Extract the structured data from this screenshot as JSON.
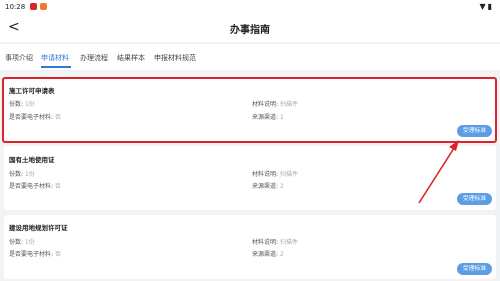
{
  "status_bar": {
    "time": "10:28"
  },
  "header": {
    "back_glyph": "<",
    "title": "办事指南"
  },
  "tabs": [
    {
      "label": "事项介绍",
      "active": false
    },
    {
      "label": "申请材料",
      "active": true
    },
    {
      "label": "办理流程",
      "active": false
    },
    {
      "label": "结果样本",
      "active": false
    },
    {
      "label": "申报材料规范",
      "active": false
    }
  ],
  "materials": [
    {
      "title": "施工许可申请表",
      "count_label": "份数:",
      "count_value": "1份",
      "desc_label": "材料说明:",
      "desc_value": "扫描件",
      "electronic_label": "是否要电子材料:",
      "electronic_value": "否",
      "source_label": "来源渠道:",
      "source_value": "1",
      "button": "受理标准"
    },
    {
      "title": "国有土地使用证",
      "count_label": "份数:",
      "count_value": "1份",
      "desc_label": "材料说明:",
      "desc_value": "扫描件",
      "electronic_label": "是否要电子材料:",
      "electronic_value": "否",
      "source_label": "来源渠道:",
      "source_value": "2",
      "button": "受理标准"
    },
    {
      "title": "建设用地规划许可证",
      "count_label": "份数:",
      "count_value": "1份",
      "desc_label": "材料说明:",
      "desc_value": "扫描件",
      "electronic_label": "是否要电子材料:",
      "electronic_value": "否",
      "source_label": "来源渠道:",
      "source_value": "2",
      "button": "受理标准"
    }
  ],
  "colors": {
    "accent": "#2f7cd8",
    "annotation": "#e0202a"
  }
}
